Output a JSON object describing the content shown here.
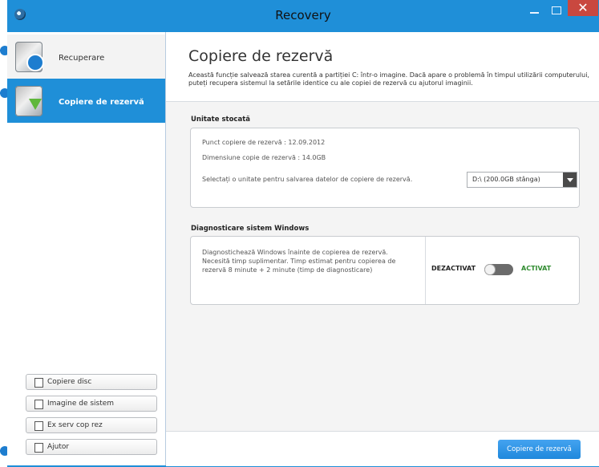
{
  "window": {
    "title": "Recovery"
  },
  "titlebar": {
    "minimize_icon": "minimize-icon",
    "maximize_icon": "maximize-icon",
    "close_icon": "close-icon",
    "close_glyph": "✕"
  },
  "sidebar": {
    "items": [
      {
        "label": "Recuperare"
      },
      {
        "label": "Copiere de rezervă"
      }
    ],
    "buttons": [
      {
        "label": "Copiere disc"
      },
      {
        "label": "Imagine de sistem"
      },
      {
        "label": "Ex serv cop rez"
      },
      {
        "label": "Ajutor"
      }
    ]
  },
  "main": {
    "title": "Copiere de rezervă",
    "description": "Această funcție salvează starea curentă a partiției C: într-o imagine. Dacă apare o problemă în timpul utilizării computerului, puteți recupera sistemul la setările identice cu ale copiei de rezervă cu ajutorul imaginii.",
    "storage": {
      "title": "Unitate stocată",
      "backup_point": "Punct copiere de rezervă : 12.09.2012",
      "backup_size": "Dimensiune copie de rezervă : 14.0GB",
      "select_label": "Selectați o unitate pentru salvarea datelor de copiere de rezervă.",
      "drive_selected": "D:\\ (200.0GB stânga)"
    },
    "diagnostics": {
      "title": "Diagnosticare sistem Windows",
      "description": "Diagnostichează Windows înainte de copierea de rezervă. Necesită timp suplimentar. Timp estimat pentru copierea de rezervă 8 minute + 2 minute (timp de diagnosticare)",
      "toggle_off": "DEZACTIVAT",
      "toggle_on": "ACTIVAT"
    },
    "primary_button": "Copiere de rezervă"
  },
  "colors": {
    "accent": "#1f8fd8",
    "close": "#c9483f",
    "activated": "#2f8b2f"
  }
}
